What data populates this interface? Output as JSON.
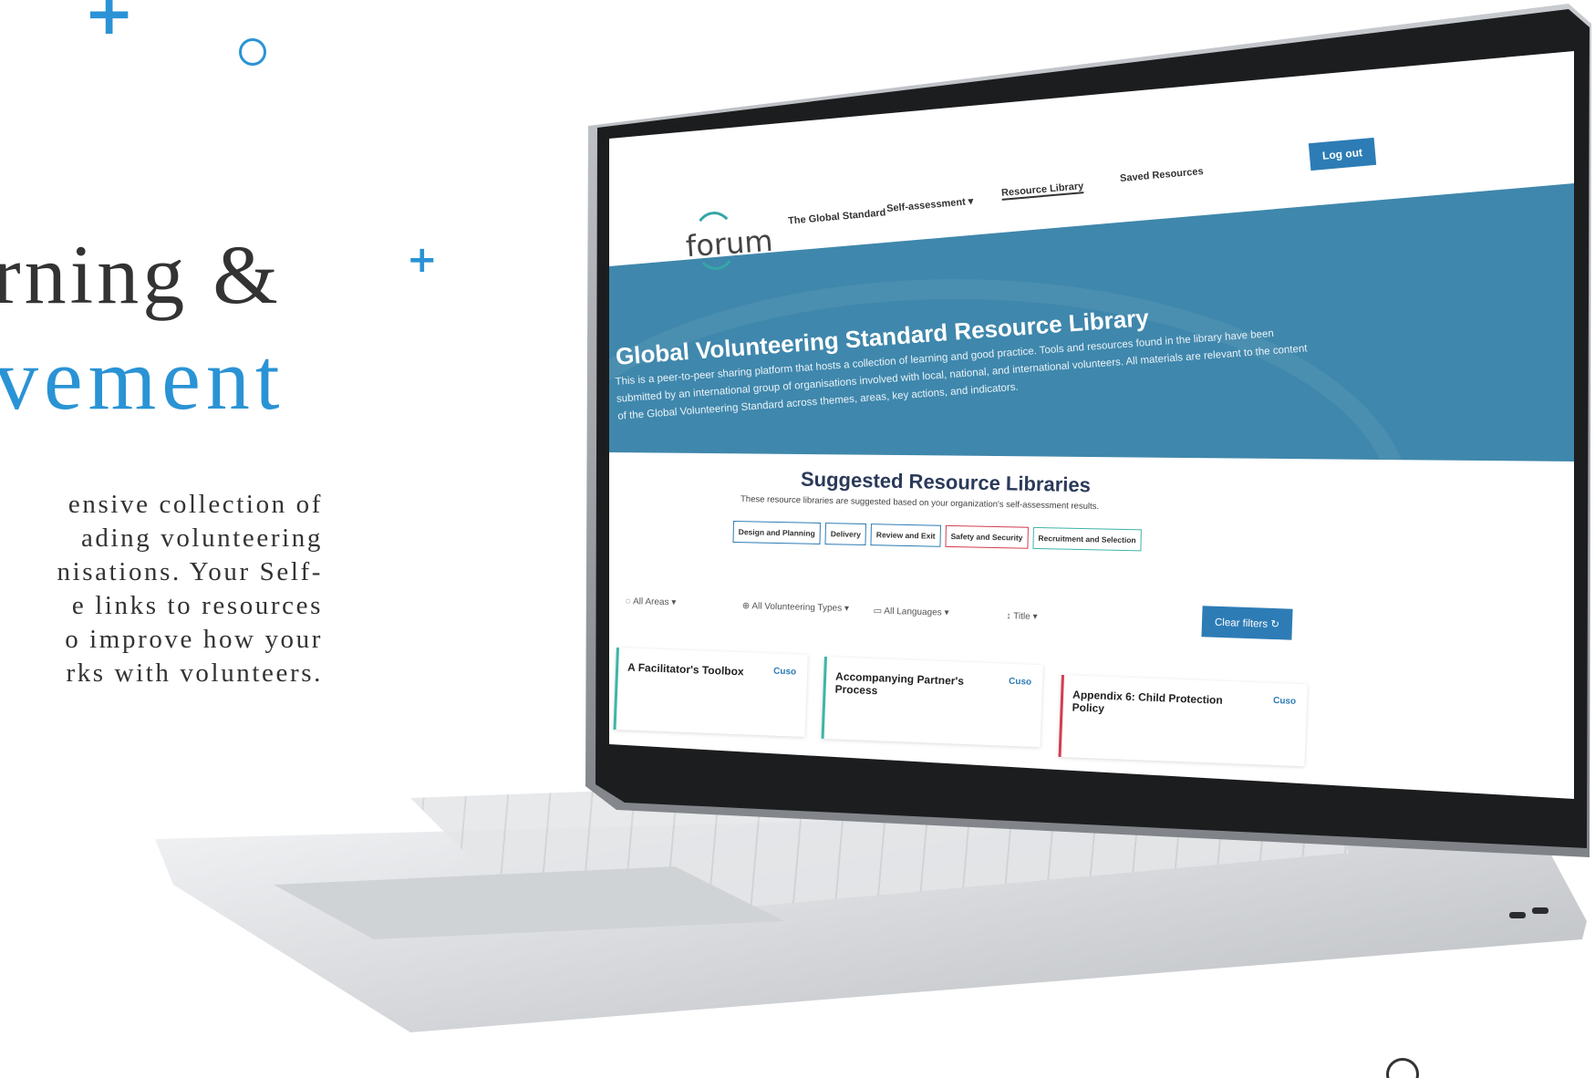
{
  "hero": {
    "line1": "rning &",
    "line2": "vement",
    "description": [
      "ensive collection of",
      "ading volunteering",
      "nisations. Your Self-",
      "e links to resources",
      "o improve how your",
      "rks with volunteers."
    ]
  },
  "site": {
    "logo": "forum",
    "nav": {
      "global_standard": "The Global Standard",
      "self_assessment": "Self-assessment",
      "resource_library": "Resource Library",
      "saved_resources": "Saved Resources",
      "logout": "Log out"
    },
    "banner": {
      "title": "Global Volunteering Standard Resource Library",
      "text": "This is a peer-to-peer sharing platform that hosts a collection of learning and good practice. Tools and resources found in the library have been submitted by an international group of organisations involved with local, national, and international volunteers. All materials are relevant to the content of the Global Volunteering Standard across themes, areas, key actions, and indicators."
    },
    "suggested": {
      "title": "Suggested Resource Libraries",
      "subtitle": "These resource libraries are suggested based on your organization's self-assessment results.",
      "chips": [
        "Design and Planning",
        "Delivery",
        "Review and Exit",
        "Safety and Security",
        "Recruitment and Selection"
      ]
    },
    "filters": {
      "areas": "All Areas",
      "types": "All Volunteering Types",
      "languages": "All Languages",
      "sort": "Title",
      "clear": "Clear filters"
    },
    "cards": [
      {
        "title": "A Facilitator's Toolbox",
        "org": "Cuso"
      },
      {
        "title": "Accompanying Partner's Process",
        "org": "Cuso"
      },
      {
        "title": "Appendix 6: Child Protection Policy",
        "org": "Cuso"
      }
    ]
  },
  "colors": {
    "accent": "#2a93d5",
    "banner": "#3f87ac",
    "button": "#2d7cb5",
    "teal": "#3cb5a8",
    "red": "#d33c50"
  }
}
